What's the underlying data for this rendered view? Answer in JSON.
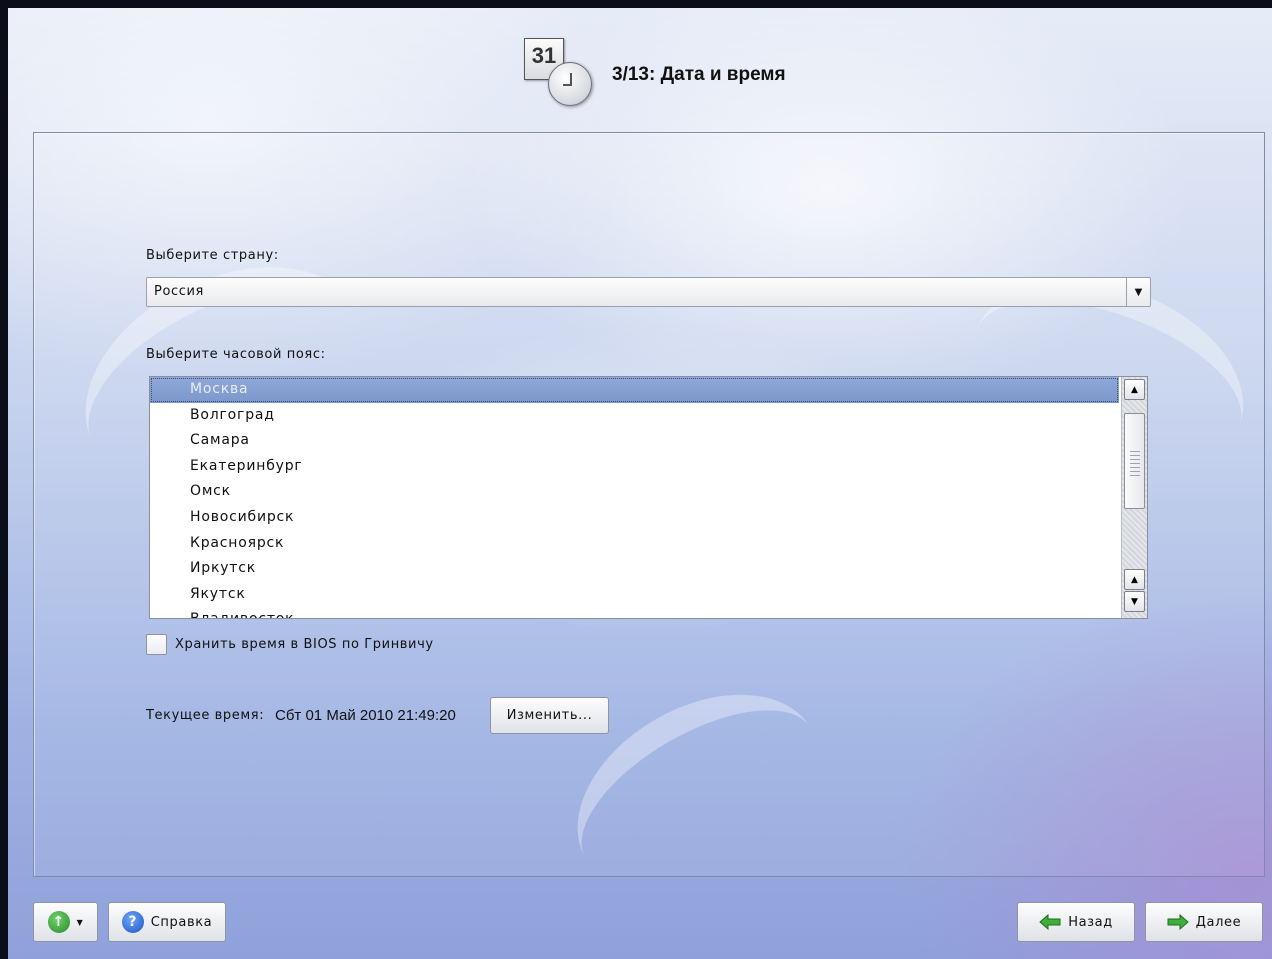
{
  "header": {
    "calendar_day": "31",
    "title": "3/13: Дата и время"
  },
  "country": {
    "label": "Выберите страну:",
    "selected": "Россия"
  },
  "timezone": {
    "label": "Выберите часовой пояс:",
    "items": [
      "Москва",
      "Волгоград",
      "Самара",
      "Екатеринбург",
      "Омск",
      "Новосибирск",
      "Красноярск",
      "Иркутск",
      "Якутск",
      "Владивосток"
    ],
    "selected_index": 0
  },
  "bios": {
    "label": "Хранить время в BIOS по Гринвичу",
    "checked": false
  },
  "current_time": {
    "label": "Текущее время:",
    "value": "Сбт 01 Май 2010 21:49:20",
    "change_label": "Изменить..."
  },
  "footer": {
    "help_label": "Справка",
    "back_label": "Назад",
    "next_label": "Далее"
  },
  "colors": {
    "selection": "#8fa8d8",
    "next_arrow": "#3fae3a",
    "help_icon": "#2a64d0"
  },
  "icons": {
    "calendar": "calendar-icon",
    "clock": "clock-icon",
    "update": "update-icon",
    "help": "help-icon",
    "back": "arrow-left-icon",
    "next": "arrow-right-icon"
  }
}
